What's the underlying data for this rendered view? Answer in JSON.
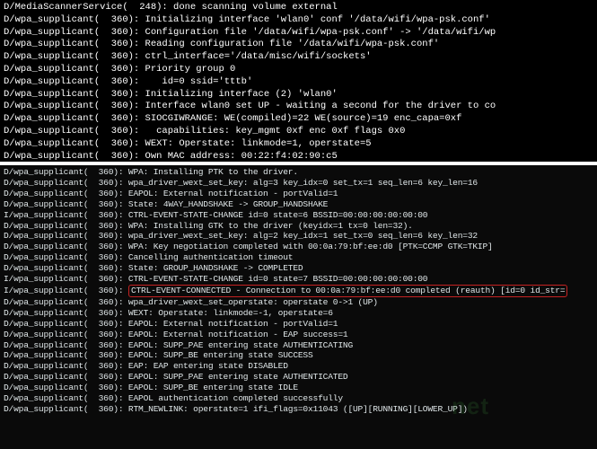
{
  "top": [
    "D/MediaScannerService(  248): done scanning volume external",
    "D/wpa_supplicant(  360): Initializing interface 'wlan0' conf '/data/wifi/wpa-psk.conf'",
    "D/wpa_supplicant(  360): Configuration file '/data/wifi/wpa-psk.conf' -> '/data/wifi/wp",
    "D/wpa_supplicant(  360): Reading configuration file '/data/wifi/wpa-psk.conf'",
    "D/wpa_supplicant(  360): ctrl_interface='/data/misc/wifi/sockets'",
    "D/wpa_supplicant(  360): Priority group 0",
    "D/wpa_supplicant(  360):    id=0 ssid='tttb'",
    "D/wpa_supplicant(  360): Initializing interface (2) 'wlan0'",
    "D/wpa_supplicant(  360): Interface wlan0 set UP - waiting a second for the driver to co",
    "D/wpa_supplicant(  360): SIOCGIWRANGE: WE(compiled)=22 WE(source)=19 enc_capa=0xf",
    "D/wpa_supplicant(  360):   capabilities: key_mgmt 0xf enc 0xf flags 0x0",
    "D/wpa_supplicant(  360): WEXT: Operstate: linkmode=1, operstate=5",
    "D/wpa_supplicant(  360): Own MAC address: 00:22:f4:02:90:c5"
  ],
  "bottom_pre": [
    "D/wpa_supplicant(  360): WPA: Installing PTK to the driver.",
    "D/wpa_supplicant(  360): wpa_driver_wext_set_key: alg=3 key_idx=0 set_tx=1 seq_len=6 key_len=16",
    "D/wpa_supplicant(  360): EAPOL: External notification - portValid=1",
    "D/wpa_supplicant(  360): State: 4WAY_HANDSHAKE -> GROUP_HANDSHAKE",
    "I/wpa_supplicant(  360): CTRL-EVENT-STATE-CHANGE id=0 state=6 BSSID=00:00:00:00:00:00",
    "D/wpa_supplicant(  360): WPA: Installing GTK to the driver (keyidx=1 tx=0 len=32).",
    "D/wpa_supplicant(  360): wpa_driver_wext_set_key: alg=2 key_idx=1 set_tx=0 seq_len=6 key_len=32",
    "D/wpa_supplicant(  360): WPA: Key negotiation completed with 00:0a:79:bf:ee:d0 [PTK=CCMP GTK=TKIP]",
    "D/wpa_supplicant(  360): Cancelling authentication timeout",
    "D/wpa_supplicant(  360): State: GROUP_HANDSHAKE -> COMPLETED",
    "I/wpa_supplicant(  360): CTRL-EVENT-STATE-CHANGE id=0 state=7 BSSID=00:00:00:00:00:00"
  ],
  "hl_prefix": "I/wpa_supplicant(  360): ",
  "hl_text": "CTRL-EVENT-CONNECTED - Connection to 00:0a:79:bf:ee:d0 completed (reauth) [id=0 id_str=",
  "bottom_post": [
    "D/wpa_supplicant(  360): wpa_driver_wext_set_operstate: operstate 0->1 (UP)",
    "D/wpa_supplicant(  360): WEXT: Operstate: linkmode=-1, operstate=6",
    "D/wpa_supplicant(  360): EAPOL: External notification - portValid=1",
    "D/wpa_supplicant(  360): EAPOL: External notification - EAP success=1",
    "D/wpa_supplicant(  360): EAPOL: SUPP_PAE entering state AUTHENTICATING",
    "D/wpa_supplicant(  360): EAPOL: SUPP_BE entering state SUCCESS",
    "D/wpa_supplicant(  360): EAP: EAP entering state DISABLED",
    "D/wpa_supplicant(  360): EAPOL: SUPP_PAE entering state AUTHENTICATED",
    "D/wpa_supplicant(  360): EAPOL: SUPP_BE entering state IDLE",
    "D/wpa_supplicant(  360): EAPOL authentication completed successfully",
    "D/wpa_supplicant(  360): RTM_NEWLINK: operstate=1 ifi_flags=0x11043 ([UP][RUNNING][LOWER_UP])"
  ],
  "watermark": "net"
}
